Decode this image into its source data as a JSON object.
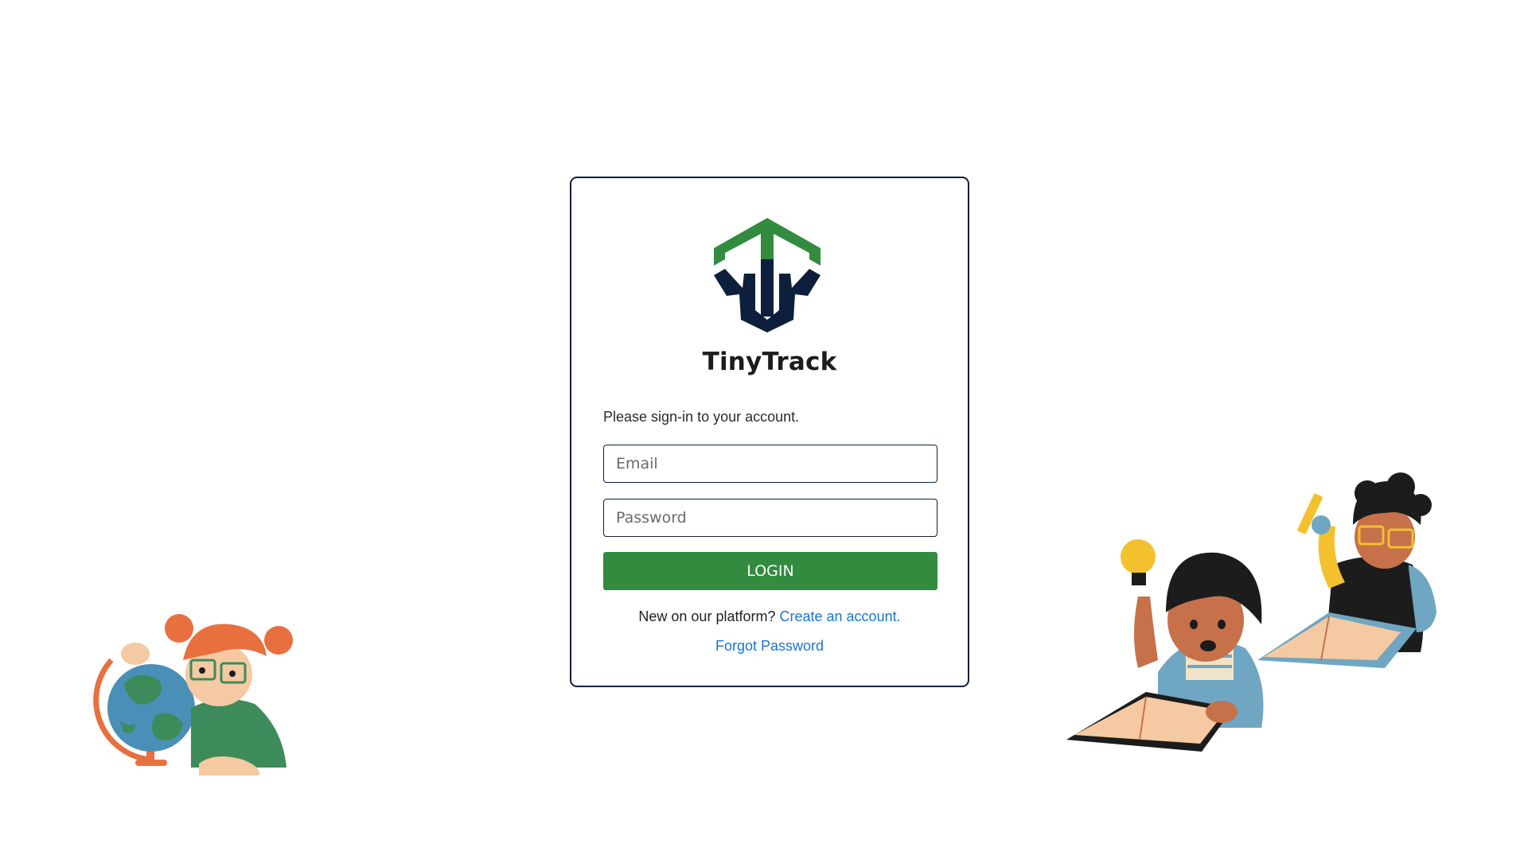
{
  "brand": {
    "name": "TinyTrack",
    "colors": {
      "green": "#328b3f",
      "navy": "#0d1f3c",
      "link": "#1a73d9"
    }
  },
  "login": {
    "prompt": "Please sign-in to your account.",
    "email_placeholder": "Email",
    "password_placeholder": "Password",
    "submit_label": "LOGIN",
    "signup_text": "New on our platform?",
    "signup_link": "Create an account.",
    "forgot_link": "Forgot Password"
  },
  "illustrations": {
    "left": "kid-with-globe",
    "right": "kids-reading-and-writing"
  }
}
